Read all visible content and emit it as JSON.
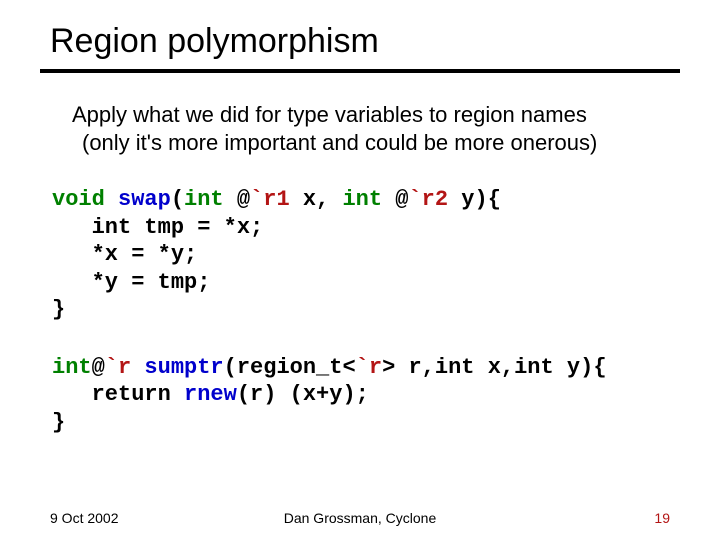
{
  "title": "Region polymorphism",
  "body": {
    "line1": "Apply what we did for type variables to region names",
    "line2": "(only it's more important and could be more onerous)"
  },
  "code1": {
    "kw_void": "void",
    "fn_swap": "swap",
    "sig_open": "(",
    "kw_int1": "int",
    "at1": " @",
    "rg_r1": "`r1",
    "x_decl": " x, ",
    "kw_int2": "int",
    "at2": " @",
    "rg_r2": "`r2",
    "y_decl": " y){",
    "l2": "   int tmp = *x;",
    "l3": "   *x = *y;",
    "l4": "   *y = tmp;",
    "l5": "}"
  },
  "code2": {
    "kw_int": "int",
    "at": "@",
    "rg_r_ret": "`r",
    "space": " ",
    "fn_sumptr": "sumptr",
    "open": "(",
    "region_t": "region_t<",
    "rg_r_param": "`r",
    "after_region": "> r,int x,int y){",
    "l2a": "   return ",
    "fn_rnew": "rnew",
    "l2b": "(r) (x+y);",
    "l3": "}"
  },
  "footer": {
    "date": "9 Oct 2002",
    "center": "Dan Grossman, Cyclone",
    "page": "19"
  }
}
